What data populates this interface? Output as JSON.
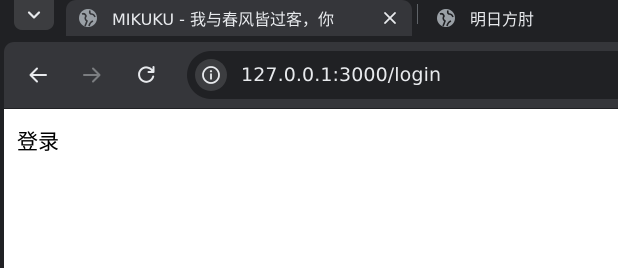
{
  "tabs": [
    {
      "title": "MIKUKU - 我与春风皆过客，你",
      "active": true
    },
    {
      "title": "明日方肘",
      "active": false
    }
  ],
  "icons": {
    "tab_search": "chevron-down-icon",
    "favicon": "globe-icon",
    "close": "close-icon",
    "back": "arrow-left-icon",
    "forward": "arrow-right-icon",
    "reload": "reload-icon",
    "site_info": "info-icon"
  },
  "omnibox": {
    "url": "127.0.0.1:3000/login"
  },
  "page": {
    "heading": "登录"
  },
  "colors": {
    "frame": "#202124",
    "toolbar": "#35363a",
    "text": "#e8eaed",
    "page_bg": "#ffffff"
  }
}
